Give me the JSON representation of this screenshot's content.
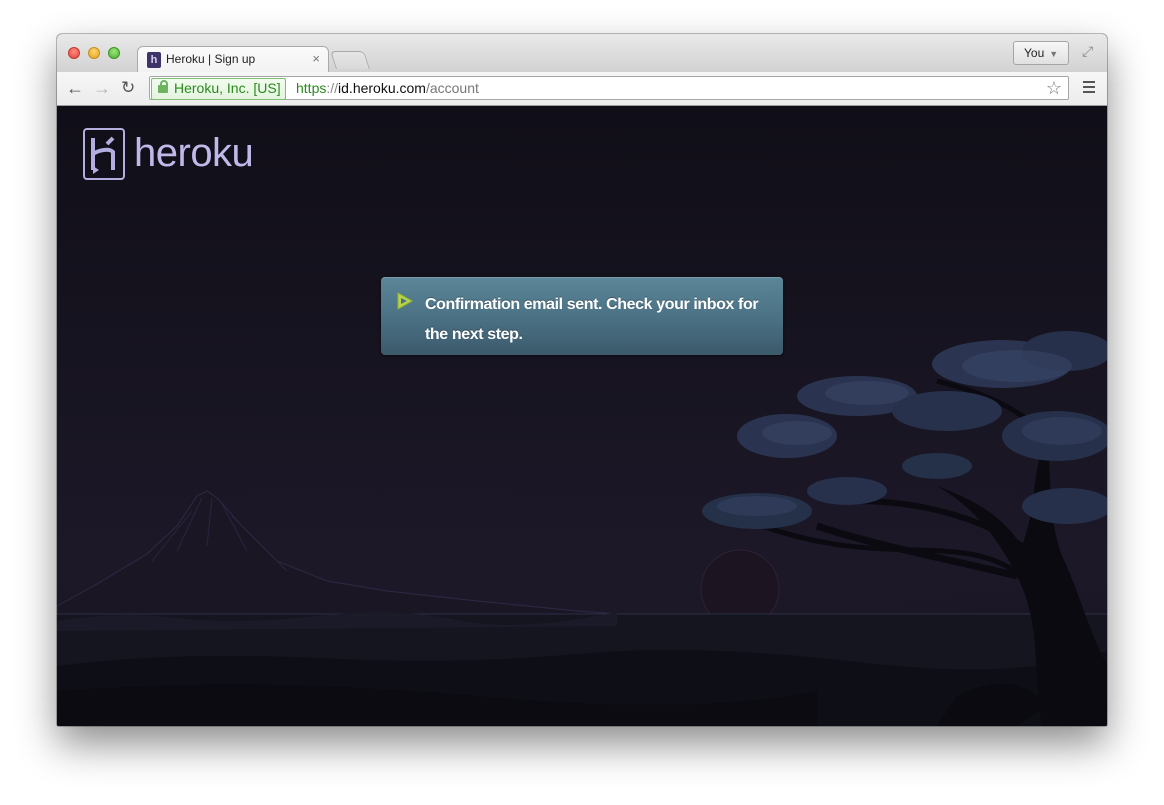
{
  "browser": {
    "tab_title": "Heroku | Sign up",
    "tab_close": "×",
    "profile_label": "You",
    "ev_label": "Heroku, Inc. [US]",
    "url": {
      "scheme": "https",
      "separator": "://",
      "host": "id.heroku.com",
      "path": "/account"
    }
  },
  "page": {
    "logo_text": "heroku",
    "flash_message": "Confirmation email sent. Check your inbox for the next step.",
    "colors": {
      "flash_bg": "#4a7083",
      "flash_icon": "#b6d34a",
      "logo": "#bfb9ea",
      "background": "#171421"
    }
  }
}
